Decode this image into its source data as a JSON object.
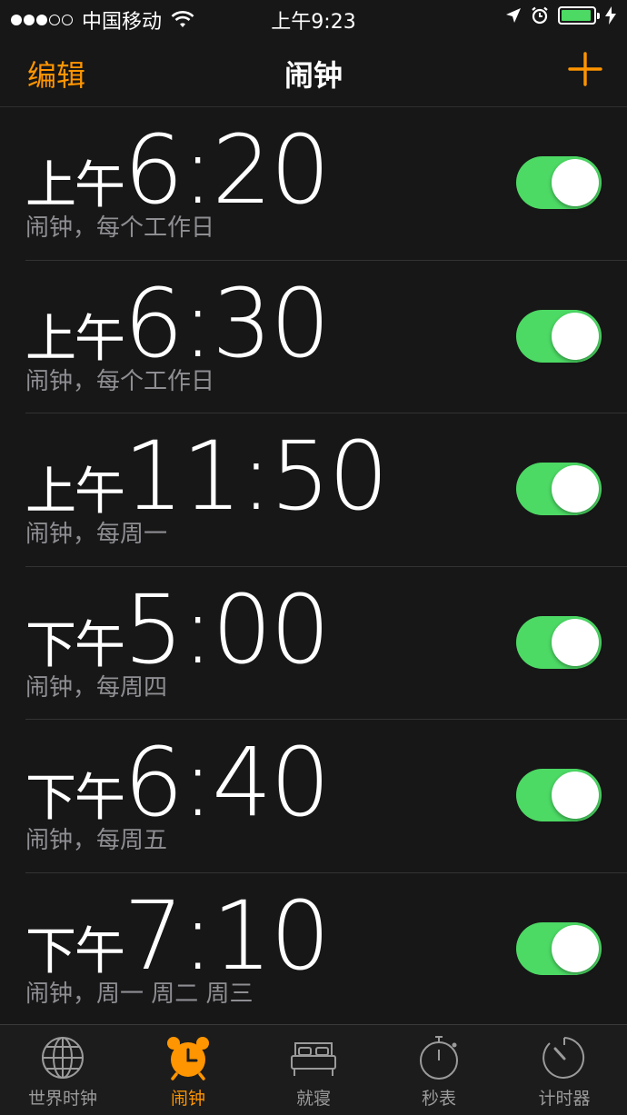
{
  "status_bar": {
    "carrier": "中国移动",
    "time": "上午9:23",
    "signal_strength": 3,
    "battery_level": 0.95
  },
  "nav": {
    "edit_label": "编辑",
    "title": "闹钟",
    "add_icon": "plus-icon"
  },
  "alarms": [
    {
      "period": "上午",
      "time": "6:20",
      "label": "闹钟，每个工作日",
      "enabled": true
    },
    {
      "period": "上午",
      "time": "6:30",
      "label": "闹钟，每个工作日",
      "enabled": true
    },
    {
      "period": "上午",
      "time": "11:50",
      "label": "闹钟，每周一",
      "enabled": true
    },
    {
      "period": "下午",
      "time": "5:00",
      "label": "闹钟，每周四",
      "enabled": true
    },
    {
      "period": "下午",
      "time": "6:40",
      "label": "闹钟，每周五",
      "enabled": true
    },
    {
      "period": "下午",
      "time": "7:10",
      "label": "闹钟，周一 周二 周三",
      "enabled": true
    }
  ],
  "tabs": [
    {
      "label": "世界时钟",
      "icon": "globe-icon",
      "active": false
    },
    {
      "label": "闹钟",
      "icon": "alarm-clock-icon",
      "active": true
    },
    {
      "label": "就寝",
      "icon": "bed-icon",
      "active": false
    },
    {
      "label": "秒表",
      "icon": "stopwatch-icon",
      "active": false
    },
    {
      "label": "计时器",
      "icon": "timer-icon",
      "active": false
    }
  ],
  "colors": {
    "accent": "#ff9500",
    "toggle_on": "#4cd964",
    "background": "#171717",
    "secondary_text": "#8e8e93"
  }
}
